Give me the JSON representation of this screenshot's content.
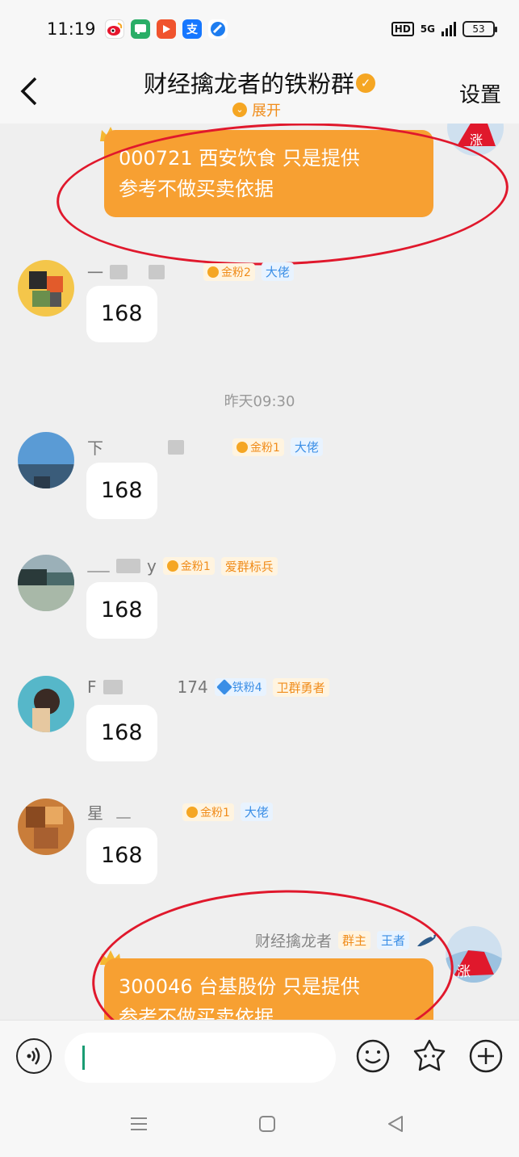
{
  "status_bar": {
    "time": "11:19",
    "network": "5G",
    "hd_label": "HD",
    "battery": "53",
    "app_icons": [
      "weibo-icon",
      "wechat-icon",
      "video-icon",
      "alipay-icon",
      "browser-icon"
    ]
  },
  "header": {
    "title": "财经擒龙者的铁粉群",
    "expand_label": "展开",
    "settings_label": "设置"
  },
  "messages": [
    {
      "text": "000721 西安饮食  只是提供参考不做买卖依据",
      "text_line1": "000721 西安饮食  只是提供",
      "text_line2": "参考不做买卖依据",
      "own": true
    },
    {
      "name_fragment": "一",
      "fan_level": "金粉2",
      "title_tag": "大佬",
      "text": "168"
    },
    {
      "name_fragment": "下",
      "fan_level": "金粉1",
      "title_tag": "大佬",
      "text": "168"
    },
    {
      "name_fragment": "y",
      "fan_level": "金粉1",
      "title_tag": "爱群标兵",
      "text": "168"
    },
    {
      "name_fragment": "F",
      "name_suffix": "174",
      "fan_level": "铁粉4",
      "title_tag": "卫群勇者",
      "text": "168"
    },
    {
      "name_fragment": "星",
      "fan_level": "金粉1",
      "title_tag": "大佬",
      "text": "168"
    },
    {
      "sender": "财经擒龙者",
      "role_tag": "群主",
      "rank_tag": "王者",
      "text_line1": "300046 台基股份  只是提供",
      "text_line2": "参考不做买卖依据"
    }
  ],
  "timestamp": "昨天09:30",
  "input": {
    "placeholder": ""
  },
  "colors": {
    "accent_orange": "#f7a032",
    "annotation_red": "#e0182c",
    "tag_blue": "#3a8ee6",
    "tag_orange": "#f08c1a"
  }
}
